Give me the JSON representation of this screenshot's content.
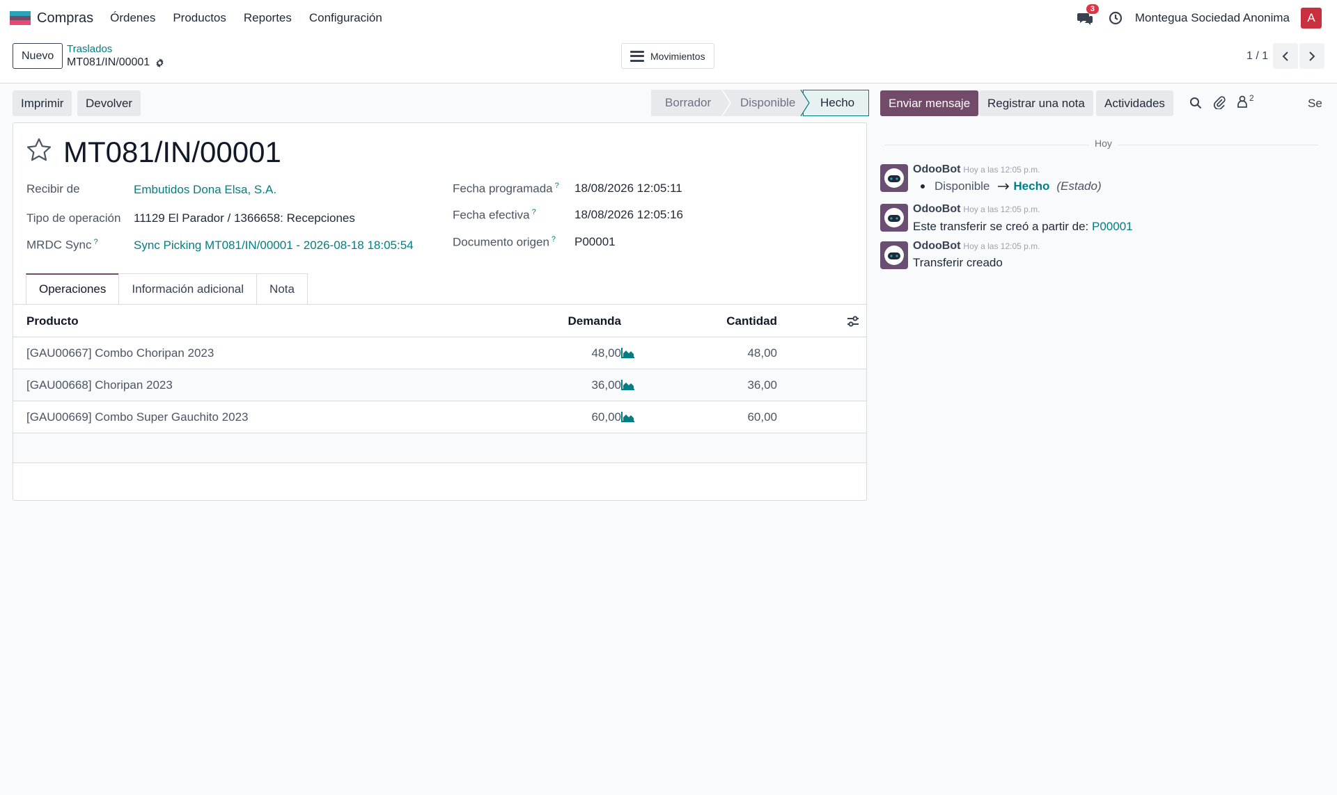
{
  "navbar": {
    "app_name": "Compras",
    "menu": [
      "Órdenes",
      "Productos",
      "Reportes",
      "Configuración"
    ],
    "notifications_count": "3",
    "company": "Montegua Sociedad Anonima",
    "user_initial": "A"
  },
  "control": {
    "new_label": "Nuevo",
    "breadcrumb_parent": "Traslados",
    "breadcrumb_current": "MT081/IN/00001",
    "moves_label": "Movimientos",
    "pager": "1 / 1"
  },
  "actions": {
    "print": "Imprimir",
    "return": "Devolver"
  },
  "status": {
    "stages": [
      "Borrador",
      "Disponible",
      "Hecho"
    ],
    "current": "Hecho"
  },
  "form": {
    "title": "MT081/IN/00001",
    "receive_from_label": "Recibir de",
    "receive_from": "Embutidos Dona Elsa, S.A.",
    "operation_type_label": "Tipo de operación",
    "operation_type": "11129 El Parador / 1366658: Recepciones",
    "mrdc_label": "MRDC Sync",
    "mrdc_value": "Sync Picking MT081/IN/00001 - 2026-08-18 18:05:54",
    "scheduled_label": "Fecha programada",
    "scheduled": "18/08/2026 12:05:11",
    "effective_label": "Fecha efectiva",
    "effective": "18/08/2026 12:05:16",
    "origin_label": "Documento origen",
    "origin": "P00001",
    "help_mark": "?"
  },
  "tabs": [
    "Operaciones",
    "Información adicional",
    "Nota"
  ],
  "table": {
    "headers": {
      "product": "Producto",
      "demand": "Demanda",
      "quantity": "Cantidad"
    },
    "rows": [
      {
        "product": "[GAU00667] Combo Choripan 2023",
        "demand": "48,00",
        "quantity": "48,00"
      },
      {
        "product": "[GAU00668] Choripan 2023",
        "demand": "36,00",
        "quantity": "36,00"
      },
      {
        "product": "[GAU00669] Combo Super Gauchito 2023",
        "demand": "60,00",
        "quantity": "60,00"
      }
    ]
  },
  "chatter": {
    "send_message": "Enviar mensaje",
    "log_note": "Registrar una nota",
    "activities": "Actividades",
    "followers_count": "2",
    "follow_label": "Seg",
    "day": "Hoy",
    "messages": [
      {
        "author": "OdooBot",
        "date": "Hoy a las 12:05 p.m.",
        "from": "Disponible",
        "to": "Hecho",
        "field": "(Estado)"
      },
      {
        "author": "OdooBot",
        "date": "Hoy a las 12:05 p.m.",
        "text": "Este transferir se creó a partir de:",
        "link": "P00001"
      },
      {
        "author": "OdooBot",
        "date": "Hoy a las 12:05 p.m.",
        "text": "Transferir creado"
      }
    ]
  },
  "colors": {
    "primary": "#714b67",
    "link": "#017e84"
  },
  "icons": [
    "app-logo-icon",
    "chat-icon",
    "clock-icon",
    "gear-icon",
    "menu-icon",
    "chevron-left-icon",
    "chevron-right-icon",
    "star-icon",
    "settings-sliders-icon",
    "area-chart-icon",
    "search-icon",
    "paperclip-icon",
    "followers-icon",
    "odoobot-avatar-icon",
    "arrow-right-icon"
  ]
}
